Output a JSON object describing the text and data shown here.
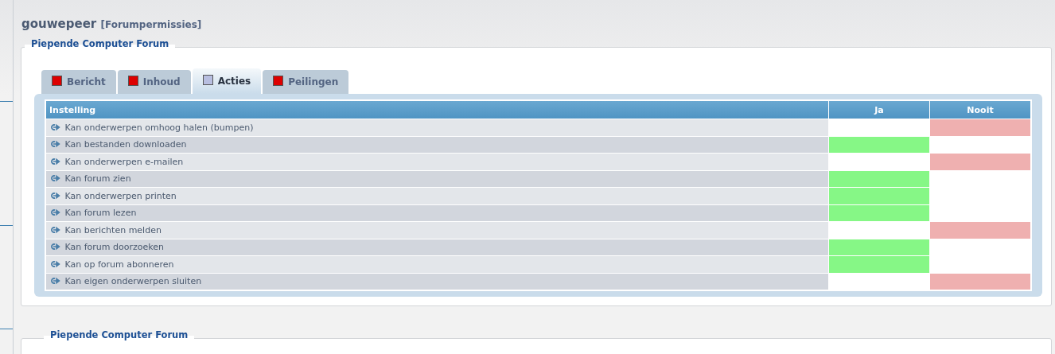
{
  "page_title": {
    "user": "gouwepeer",
    "context": "[Forumpermissies]"
  },
  "sections": [
    {
      "legend": "Piepende Computer Forum",
      "tabs": [
        {
          "label": "Bericht",
          "selected": false,
          "color": "#dd0000"
        },
        {
          "label": "Inhoud",
          "selected": false,
          "color": "#dd0000"
        },
        {
          "label": "Acties",
          "selected": true,
          "color": "#b8bee0"
        },
        {
          "label": "Peilingen",
          "selected": false,
          "color": "#dd0000"
        }
      ],
      "table": {
        "columns": [
          "Instelling",
          "Ja",
          "Nooit"
        ],
        "rows": [
          {
            "label": "Kan onderwerpen omhoog halen (bumpen)",
            "ja": false,
            "nooit": true
          },
          {
            "label": "Kan bestanden downloaden",
            "ja": true,
            "nooit": false
          },
          {
            "label": "Kan onderwerpen e-mailen",
            "ja": false,
            "nooit": true
          },
          {
            "label": "Kan forum zien",
            "ja": true,
            "nooit": false
          },
          {
            "label": "Kan onderwerpen printen",
            "ja": true,
            "nooit": false
          },
          {
            "label": "Kan forum lezen",
            "ja": true,
            "nooit": false
          },
          {
            "label": "Kan berichten melden",
            "ja": false,
            "nooit": true
          },
          {
            "label": "Kan forum doorzoeken",
            "ja": true,
            "nooit": false
          },
          {
            "label": "Kan op forum abonneren",
            "ja": true,
            "nooit": false
          },
          {
            "label": "Kan eigen onderwerpen sluiten",
            "ja": false,
            "nooit": true
          }
        ]
      }
    },
    {
      "legend": "Piepende Computer Forum"
    }
  ]
}
